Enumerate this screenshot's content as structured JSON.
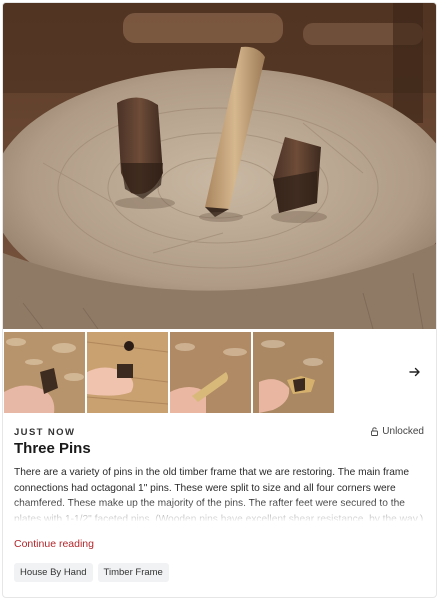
{
  "post": {
    "timestamp": "JUST NOW",
    "access_label": "Unlocked",
    "title": "Three Pins",
    "excerpt": "There are a variety of pins in the old timber frame that we are restoring. The main frame connections had octagonal 1\" pins. These were split to size and all four corners were chamfered. These make up the majority of the pins. The rafter feet were secured to the plates with 1-1/2\" faceted pins. (Wooden pins have excellent shear resistance, by the way.)",
    "continue_label": "Continue reading",
    "tags": [
      "House By Hand",
      "Timber Frame"
    ]
  },
  "gallery": {
    "next_icon": "arrow-right-icon",
    "thumbnail_count": 4
  },
  "colors": {
    "accent": "#b3262b",
    "tag_bg": "#f1f2f4"
  }
}
